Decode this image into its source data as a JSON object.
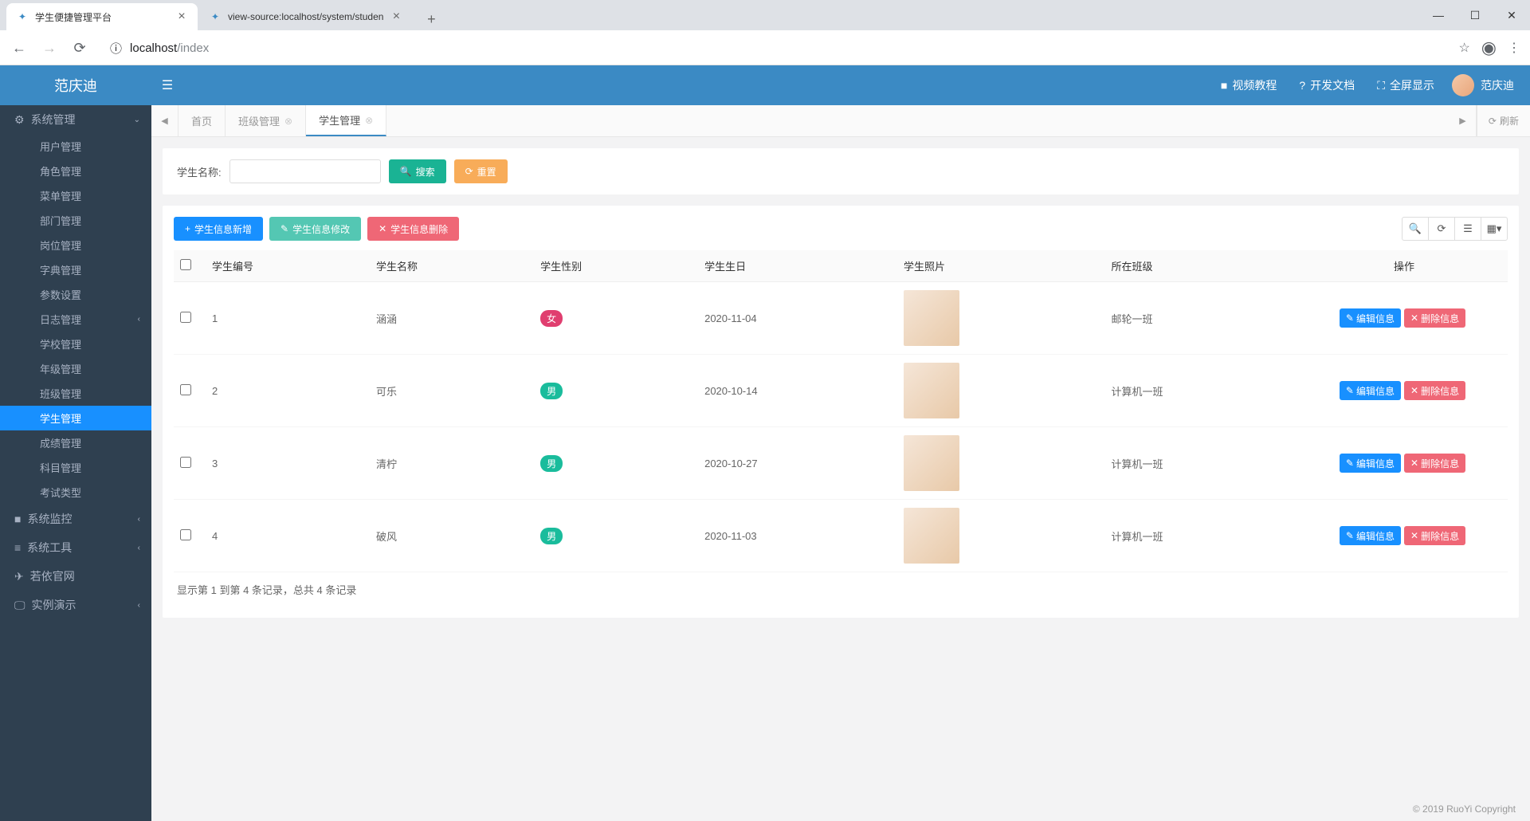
{
  "browser": {
    "tabs": [
      {
        "title": "学生便捷管理平台"
      },
      {
        "title": "view-source:localhost/system/studen"
      }
    ],
    "url_host": "localhost",
    "url_path": "/index"
  },
  "header": {
    "brand": "范庆迪",
    "links": {
      "video": "视频教程",
      "doc": "开发文档",
      "fullscreen": "全屏显示"
    },
    "username": "范庆迪"
  },
  "sidebar": {
    "group_system": "系统管理",
    "items": [
      "用户管理",
      "角色管理",
      "菜单管理",
      "部门管理",
      "岗位管理",
      "字典管理",
      "参数设置",
      "日志管理",
      "学校管理",
      "年级管理",
      "班级管理",
      "学生管理",
      "成绩管理",
      "科目管理",
      "考试类型"
    ],
    "active_item": "学生管理",
    "group_monitor": "系统监控",
    "group_tool": "系统工具",
    "group_site": "若依官网",
    "group_demo": "实例演示"
  },
  "tabs": {
    "home": "首页",
    "class": "班级管理",
    "student": "学生管理",
    "refresh": "刷新"
  },
  "search": {
    "label": "学生名称:",
    "search_btn": "搜索",
    "reset_btn": "重置"
  },
  "toolbar": {
    "add": "学生信息新增",
    "edit": "学生信息修改",
    "del": "学生信息删除"
  },
  "table": {
    "cols": {
      "id": "学生编号",
      "name": "学生名称",
      "gender": "学生性别",
      "birthday": "学生生日",
      "photo": "学生照片",
      "class": "所在班级",
      "op": "操作"
    },
    "rows": [
      {
        "id": "1",
        "name": "涵涵",
        "gender": "女",
        "gender_cls": "female",
        "birthday": "2020-11-04",
        "class": "邮轮一班"
      },
      {
        "id": "2",
        "name": "可乐",
        "gender": "男",
        "gender_cls": "male",
        "birthday": "2020-10-14",
        "class": "计算机一班"
      },
      {
        "id": "3",
        "name": "清柠",
        "gender": "男",
        "gender_cls": "male",
        "birthday": "2020-10-27",
        "class": "计算机一班"
      },
      {
        "id": "4",
        "name": "破风",
        "gender": "男",
        "gender_cls": "male",
        "birthday": "2020-11-03",
        "class": "计算机一班"
      }
    ],
    "op_edit": "编辑信息",
    "op_del": "删除信息"
  },
  "pager": "显示第 1 到第 4 条记录，总共 4 条记录",
  "footer": "© 2019 RuoYi Copyright"
}
